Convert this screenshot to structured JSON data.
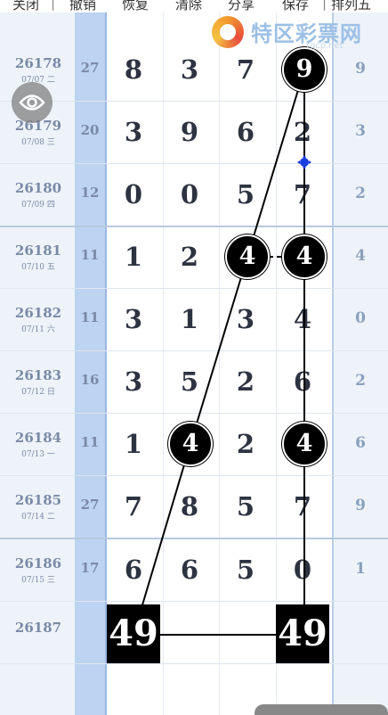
{
  "toolbar": {
    "items": [
      "关闭",
      "撤销",
      "恢复",
      "清除",
      "分享",
      "保存",
      "排列五"
    ]
  },
  "logo": {
    "text": "特区彩票网",
    "url": "tqcp.net"
  },
  "rows": [
    {
      "issue": "26178",
      "date": "07/07 二",
      "sum": "27",
      "digits": [
        "8",
        "3",
        "7",
        "9"
      ],
      "tail": "9"
    },
    {
      "issue": "26179",
      "date": "07/08 三",
      "sum": "20",
      "digits": [
        "3",
        "9",
        "6",
        "2"
      ],
      "tail": "3"
    },
    {
      "issue": "26180",
      "date": "07/09 四",
      "sum": "12",
      "digits": [
        "0",
        "0",
        "5",
        "7"
      ],
      "tail": "2"
    },
    {
      "issue": "26181",
      "date": "07/10 五",
      "sum": "11",
      "digits": [
        "1",
        "2",
        "4",
        "4"
      ],
      "tail": "4"
    },
    {
      "issue": "26182",
      "date": "07/11 六",
      "sum": "11",
      "digits": [
        "3",
        "1",
        "3",
        "4"
      ],
      "tail": "0"
    },
    {
      "issue": "26183",
      "date": "07/12 日",
      "sum": "16",
      "digits": [
        "3",
        "5",
        "2",
        "6"
      ],
      "tail": "2"
    },
    {
      "issue": "26184",
      "date": "07/13 一",
      "sum": "11",
      "digits": [
        "1",
        "4",
        "2",
        "4"
      ],
      "tail": "6"
    },
    {
      "issue": "26185",
      "date": "07/14 二",
      "sum": "27",
      "digits": [
        "7",
        "8",
        "5",
        "7"
      ],
      "tail": "9"
    },
    {
      "issue": "26186",
      "date": "07/15 三",
      "sum": "17",
      "digits": [
        "6",
        "6",
        "5",
        "0"
      ],
      "tail": "1"
    },
    {
      "issue": "26187",
      "date": "",
      "sum": "",
      "digits": [
        "",
        "",
        "",
        ""
      ],
      "tail": ""
    }
  ],
  "prediction": {
    "left": "49",
    "right": "49"
  },
  "icons": {
    "eye": "eye-icon",
    "handle": "move-handle-icon"
  },
  "colors": {
    "highlight_col": "#bcd3f1",
    "ball": "#000000",
    "text": "#2d3340"
  }
}
